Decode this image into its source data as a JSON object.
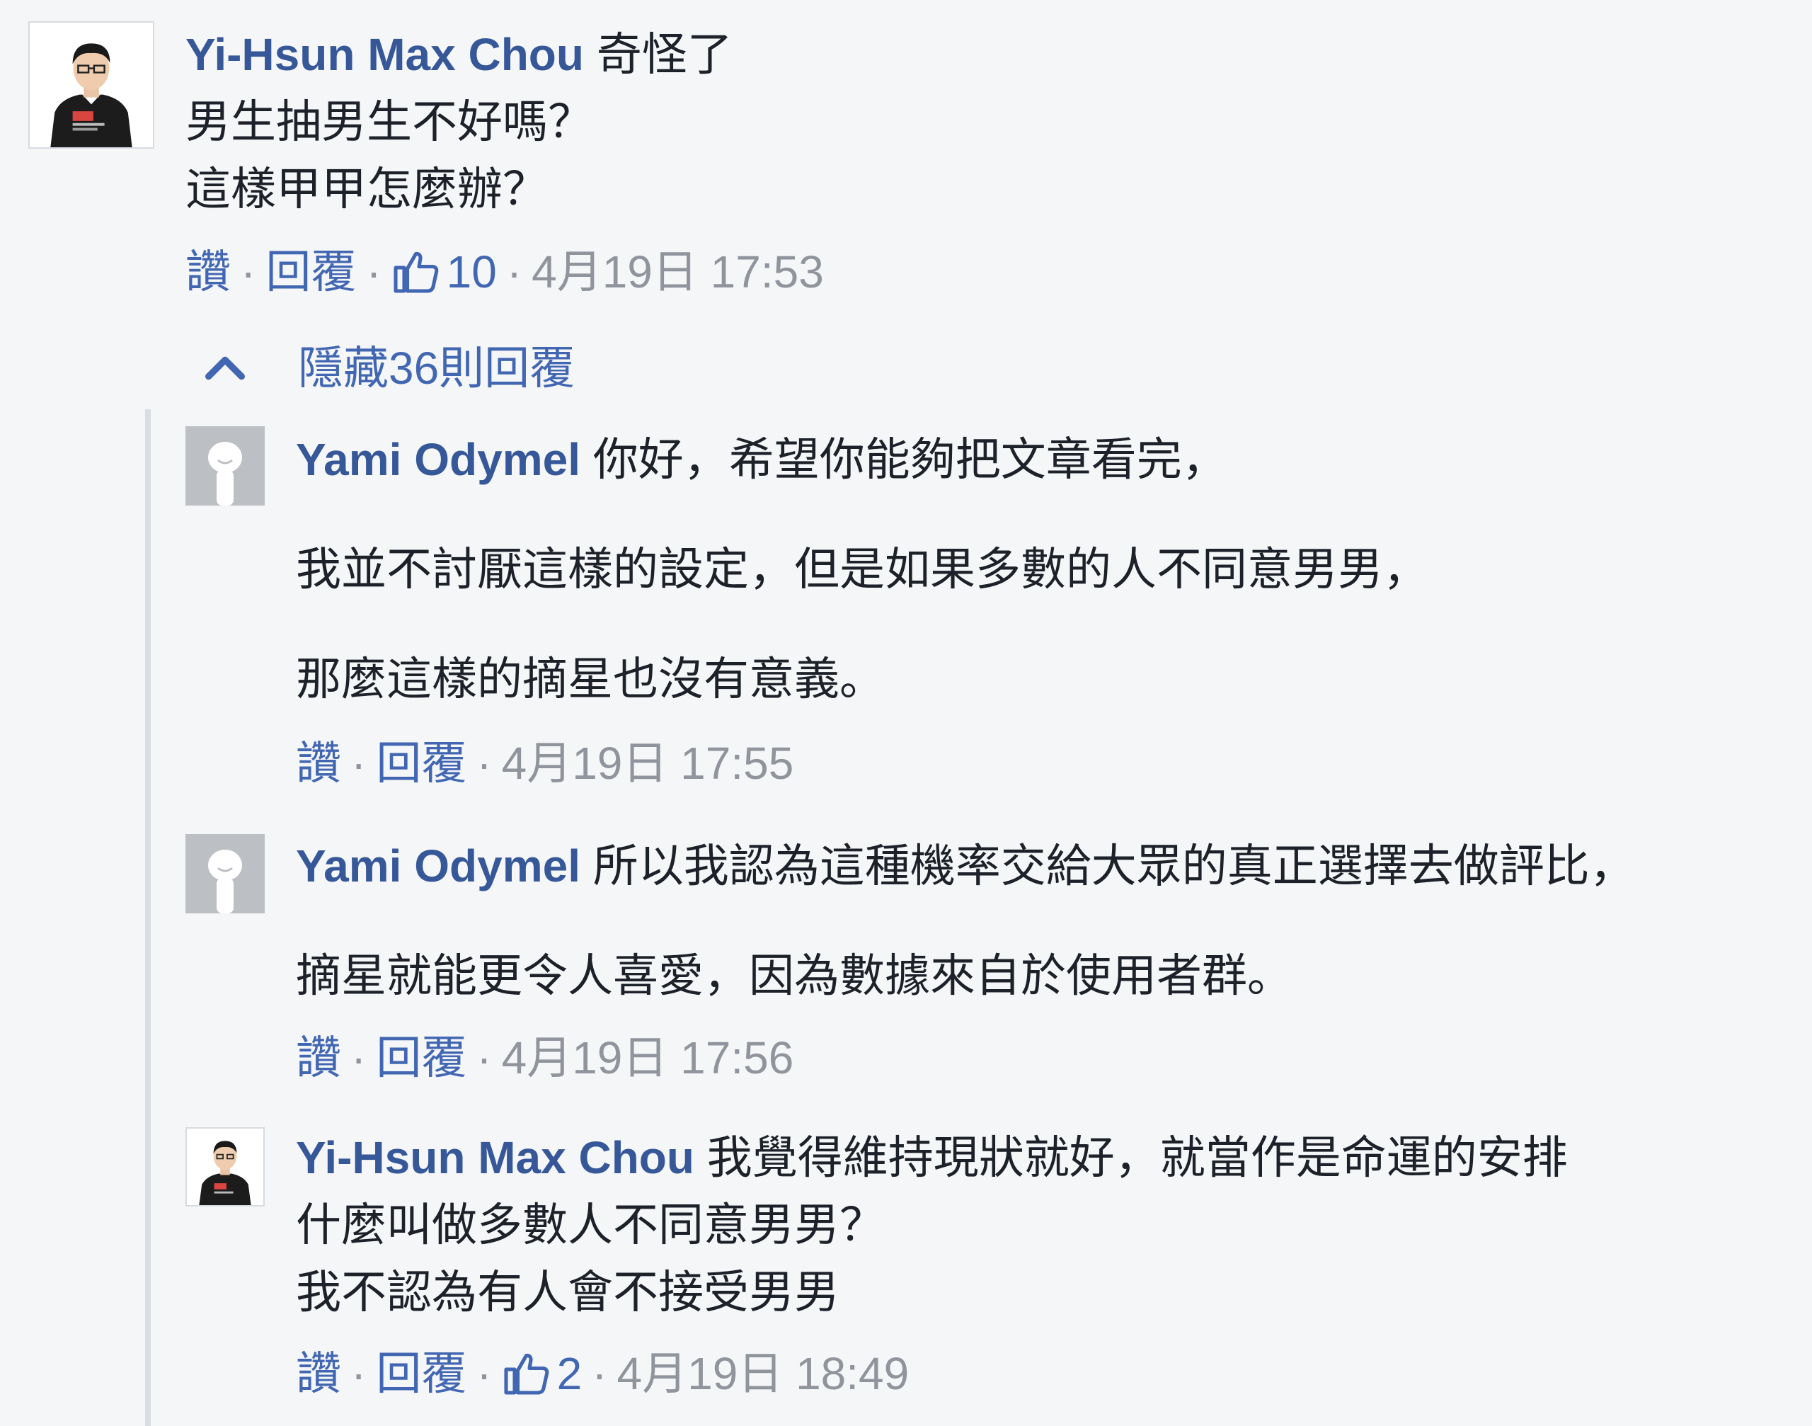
{
  "comments": [
    {
      "author": "Yi-Hsun Max Chou",
      "lines": [
        "奇怪了",
        "男生抽男生不好嗎？",
        "這樣甲甲怎麼辦？"
      ],
      "like_label": "讚",
      "reply_label": "回覆",
      "like_count": "10",
      "timestamp": "4月19日 17:53"
    }
  ],
  "replies_toggle": {
    "label": "隱藏36則回覆",
    "icon": "chevron-up-icon"
  },
  "replies": [
    {
      "author": "Yami Odymel",
      "lines": [
        "你好，希望你能夠把文章看完，",
        "我並不討厭這樣的設定，但是如果多數的人不同意男男，",
        "那麼這樣的摘星也沒有意義。"
      ],
      "like_label": "讚",
      "reply_label": "回覆",
      "timestamp": "4月19日 17:55"
    },
    {
      "author": "Yami Odymel",
      "lines": [
        "所以我認為這種機率交給大眾的真正選擇去做評比，",
        "摘星就能更令人喜愛，因為數據來自於使用者群。"
      ],
      "like_label": "讚",
      "reply_label": "回覆",
      "timestamp": "4月19日 17:56"
    },
    {
      "author": "Yi-Hsun Max Chou",
      "lines": [
        "我覺得維持現狀就好，就當作是命運的安排",
        "什麼叫做多數人不同意男男？",
        "我不認為有人會不接受男男"
      ],
      "like_label": "讚",
      "reply_label": "回覆",
      "like_count": "2",
      "timestamp": "4月19日 18:49"
    }
  ],
  "colors": {
    "background": "#f5f6f7",
    "author": "#365899",
    "link": "#4267b2",
    "meta": "#90949c",
    "text": "#1d2129"
  }
}
